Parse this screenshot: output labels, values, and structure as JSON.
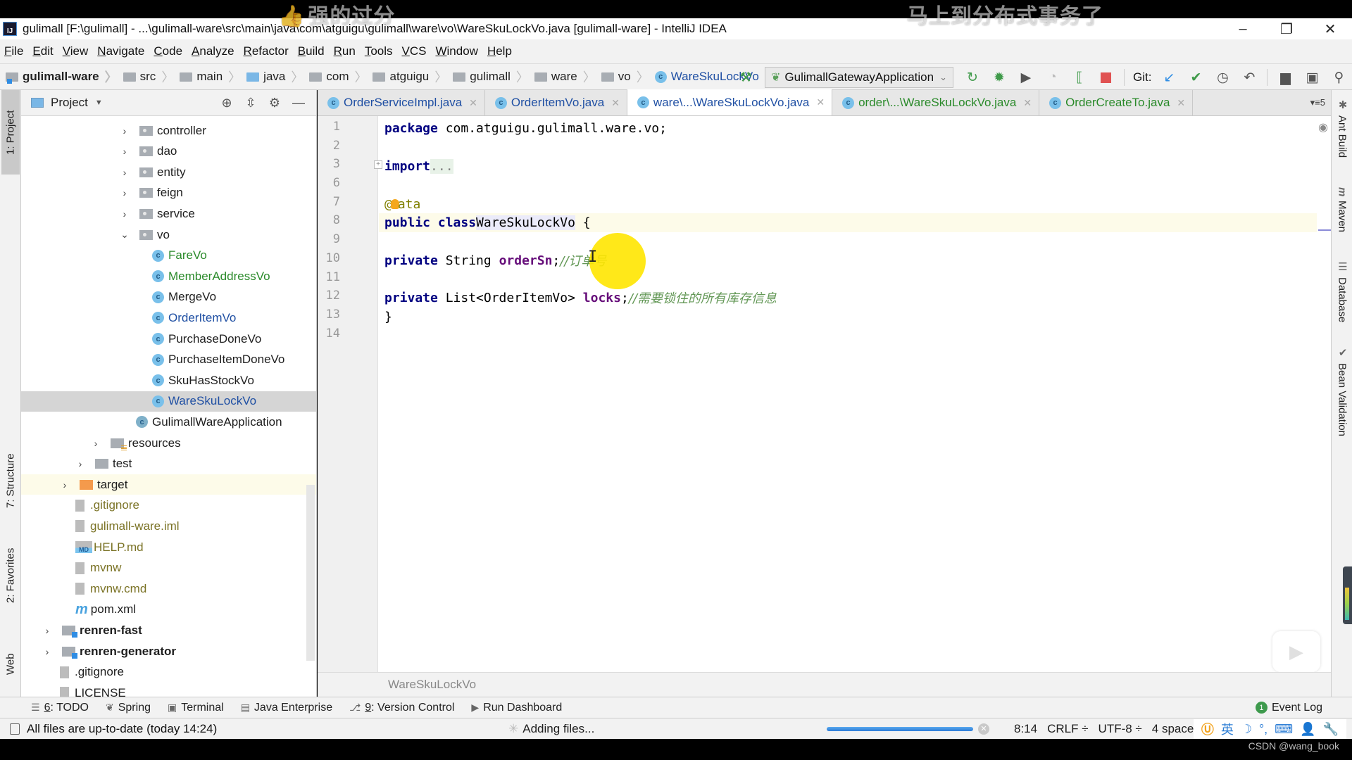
{
  "overlays": {
    "danmaku_left": "强的过分",
    "danmaku_right": "马上到分布式事务了",
    "watermark": "CSDN @wang_book"
  },
  "window": {
    "app_icon": "IJ",
    "title": "gulimall [F:\\gulimall] - ...\\gulimall-ware\\src\\main\\java\\com\\atguigu\\gulimall\\ware\\vo\\WareSkuLockVo.java [gulimall-ware] - IntelliJ IDEA",
    "minimize": "–",
    "restore": "❐",
    "close": "✕"
  },
  "menu": [
    "File",
    "Edit",
    "View",
    "Navigate",
    "Code",
    "Analyze",
    "Refactor",
    "Build",
    "Run",
    "Tools",
    "VCS",
    "Window",
    "Help"
  ],
  "breadcrumb": [
    "gulimall-ware",
    "src",
    "main",
    "java",
    "com",
    "atguigu",
    "gulimall",
    "ware",
    "vo",
    "WareSkuLockVo"
  ],
  "toolbar": {
    "run_config": "GulimallGatewayApplication",
    "git_label": "Git:"
  },
  "left_stripe": {
    "project": "1: Project",
    "structure": "7: Structure",
    "favorites": "2: Favorites",
    "web": "Web"
  },
  "project_panel": {
    "title": "Project",
    "tree": [
      {
        "label": "controller",
        "type": "package",
        "expanded": false
      },
      {
        "label": "dao",
        "type": "package",
        "expanded": false
      },
      {
        "label": "entity",
        "type": "package",
        "expanded": false
      },
      {
        "label": "feign",
        "type": "package",
        "expanded": false
      },
      {
        "label": "service",
        "type": "package",
        "expanded": false
      },
      {
        "label": "vo",
        "type": "package",
        "expanded": true
      },
      {
        "label": "FareVo",
        "type": "class",
        "status": "added"
      },
      {
        "label": "MemberAddressVo",
        "type": "class",
        "status": "added"
      },
      {
        "label": "MergeVo",
        "type": "class",
        "status": "normal"
      },
      {
        "label": "OrderItemVo",
        "type": "class",
        "status": "modified"
      },
      {
        "label": "PurchaseDoneVo",
        "type": "class",
        "status": "normal"
      },
      {
        "label": "PurchaseItemDoneVo",
        "type": "class",
        "status": "normal"
      },
      {
        "label": "SkuHasStockVo",
        "type": "class",
        "status": "normal"
      },
      {
        "label": "WareSkuLockVo",
        "type": "class",
        "status": "modified",
        "selected": true
      },
      {
        "label": "GulimallWareApplication",
        "type": "spring-class",
        "status": "normal"
      },
      {
        "label": "resources",
        "type": "resources-folder",
        "expanded": false
      },
      {
        "label": "test",
        "type": "folder",
        "expanded": false
      },
      {
        "label": "target",
        "type": "excluded-folder",
        "expanded": false
      },
      {
        "label": ".gitignore",
        "type": "file",
        "status": "ignored"
      },
      {
        "label": "gulimall-ware.iml",
        "type": "iml-file",
        "status": "ignored"
      },
      {
        "label": "HELP.md",
        "type": "md-file",
        "status": "ignored"
      },
      {
        "label": "mvnw",
        "type": "file",
        "status": "ignored"
      },
      {
        "label": "mvnw.cmd",
        "type": "file",
        "status": "ignored"
      },
      {
        "label": "pom.xml",
        "type": "maven-file",
        "status": "normal"
      },
      {
        "label": "renren-fast",
        "type": "module",
        "expanded": false
      },
      {
        "label": "renren-generator",
        "type": "module",
        "expanded": false
      },
      {
        "label": ".gitignore",
        "type": "file",
        "status": "normal"
      },
      {
        "label": "LICENSE",
        "type": "file",
        "status": "normal"
      }
    ]
  },
  "tabs": [
    {
      "label": "OrderServiceImpl.java",
      "active": false,
      "color": "blue"
    },
    {
      "label": "OrderItemVo.java",
      "active": false,
      "color": "blue"
    },
    {
      "label": "ware\\...\\WareSkuLockVo.java",
      "active": true,
      "color": "blue"
    },
    {
      "label": "order\\...\\WareSkuLockVo.java",
      "active": false,
      "color": "green"
    },
    {
      "label": "OrderCreateTo.java",
      "active": false,
      "color": "green"
    }
  ],
  "tabs_overflow": "▾≡5",
  "editor": {
    "line_numbers": [
      "1",
      "2",
      "3",
      "6",
      "7",
      "8",
      "9",
      "10",
      "11",
      "12",
      "13",
      "14"
    ],
    "code": {
      "l1_kw": "package",
      "l1_rest": " com.atguigu.gulimall.ware.vo;",
      "l3_kw": "import",
      "l3_fold": "...",
      "l7_at": "@",
      "l7_rest": "ata",
      "l8_kw": "public class",
      "l8_cls": "WareSkuLockVo",
      "l8_rest": " {",
      "l10_kw": "private",
      "l10_type": " String ",
      "l10_field": "orderSn",
      "l10_semi": ";",
      "l10_cmt": "//订单号",
      "l12_kw": "private",
      "l12_type": " List<OrderItemVo> ",
      "l12_field": "locks",
      "l12_semi": ";",
      "l12_cmt": "//需要锁住的所有库存信息",
      "l13": "}"
    },
    "breadcrumb": "WareSkuLockVo"
  },
  "right_stripe": {
    "ant": "Ant Build",
    "maven": "Maven",
    "database": "Database",
    "bean": "Bean Validation"
  },
  "tool_windows": [
    {
      "num": "6",
      "label": ": TODO"
    },
    {
      "num": "",
      "label": "Spring"
    },
    {
      "num": "",
      "label": "Terminal"
    },
    {
      "num": "",
      "label": "Java Enterprise"
    },
    {
      "num": "9",
      "label": ": Version Control"
    },
    {
      "num": "",
      "label": "Run Dashboard"
    }
  ],
  "event_log": {
    "count": "1",
    "label": "Event Log"
  },
  "status": {
    "message": "All files are up-to-date (today 14:24)",
    "task": "Adding files...",
    "progress": 1.0,
    "position": "8:14",
    "line_sep": "CRLF ÷",
    "encoding": "UTF-8 ÷",
    "indent": "4 spaces",
    "ime_lang": "英"
  }
}
